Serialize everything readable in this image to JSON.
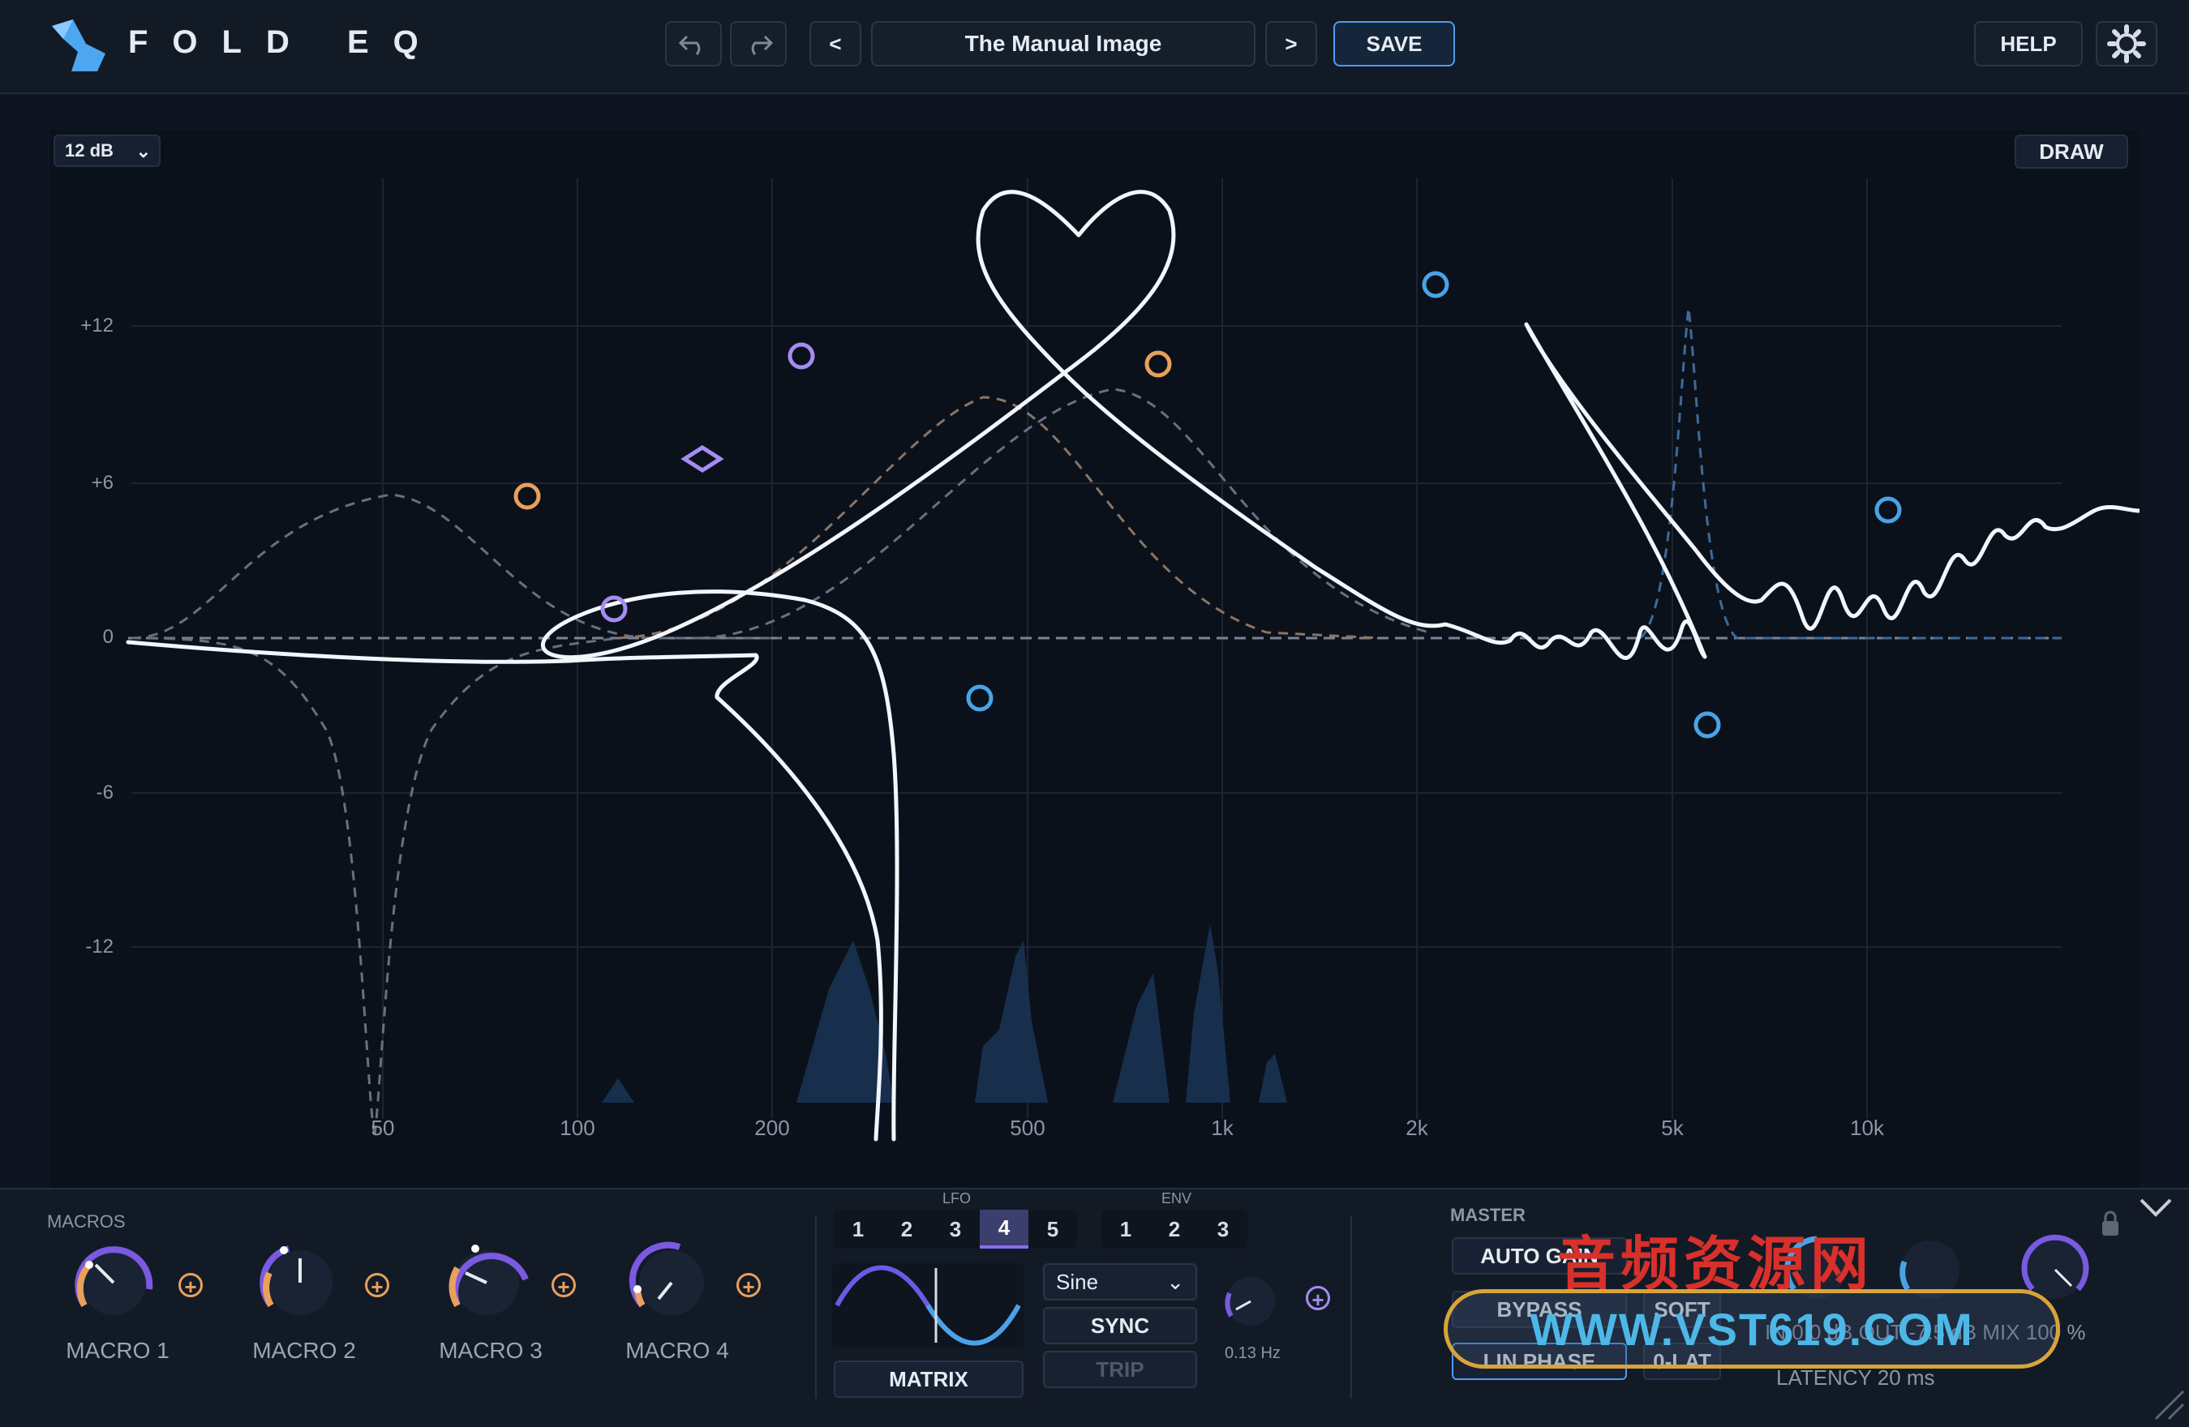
{
  "app": {
    "title": "FOLD EQ"
  },
  "toolbar": {
    "undo_icon": "undo-icon",
    "redo_icon": "redo-icon",
    "prev_label": "<",
    "next_label": ">",
    "preset_name": "The Manual Image",
    "save_label": "SAVE",
    "help_label": "HELP",
    "settings_icon": "gear-icon"
  },
  "eq": {
    "range_select": "12 dB",
    "draw_label": "DRAW",
    "y_ticks": [
      "+12",
      "+6",
      "0",
      "-6",
      "-12"
    ],
    "x_ticks": [
      "50",
      "100",
      "200",
      "500",
      "1k",
      "2k",
      "5k",
      "10k"
    ],
    "colors": {
      "orange": "#e8a05c",
      "purple": "#a58cf0",
      "blue": "#4aa3e8",
      "curve": "#f2f6fb"
    }
  },
  "macros": {
    "section_label": "MACROS",
    "items": [
      {
        "label": "MACRO 1",
        "value": 0.35
      },
      {
        "label": "MACRO 2",
        "value": 0.5
      },
      {
        "label": "MACRO 3",
        "value": 0.3
      },
      {
        "label": "MACRO 4",
        "value": 0.2
      }
    ]
  },
  "lfo": {
    "section_label": "LFO",
    "tabs": [
      "1",
      "2",
      "3",
      "4",
      "5"
    ],
    "active_tab": "4",
    "shape": "Sine",
    "sync_label": "SYNC",
    "trip_label": "TRIP",
    "matrix_label": "MATRIX",
    "rate": "0.13 Hz"
  },
  "env": {
    "section_label": "ENV",
    "tabs": [
      "1",
      "2",
      "3"
    ]
  },
  "master": {
    "section_label": "MASTER",
    "auto_gain": "AUTO GAIN",
    "bypass": "BYPASS",
    "soft": "SOFT",
    "lin_phase": "LIN PHASE",
    "zero_lat": "0-LAT",
    "io_readout": "IN 0.0 dB OUT -7.5 dB MIX 100 %",
    "latency": "LATENCY 20 ms"
  },
  "watermark": {
    "cn": "音频资源网",
    "url": "WWW.VST619.COM"
  }
}
